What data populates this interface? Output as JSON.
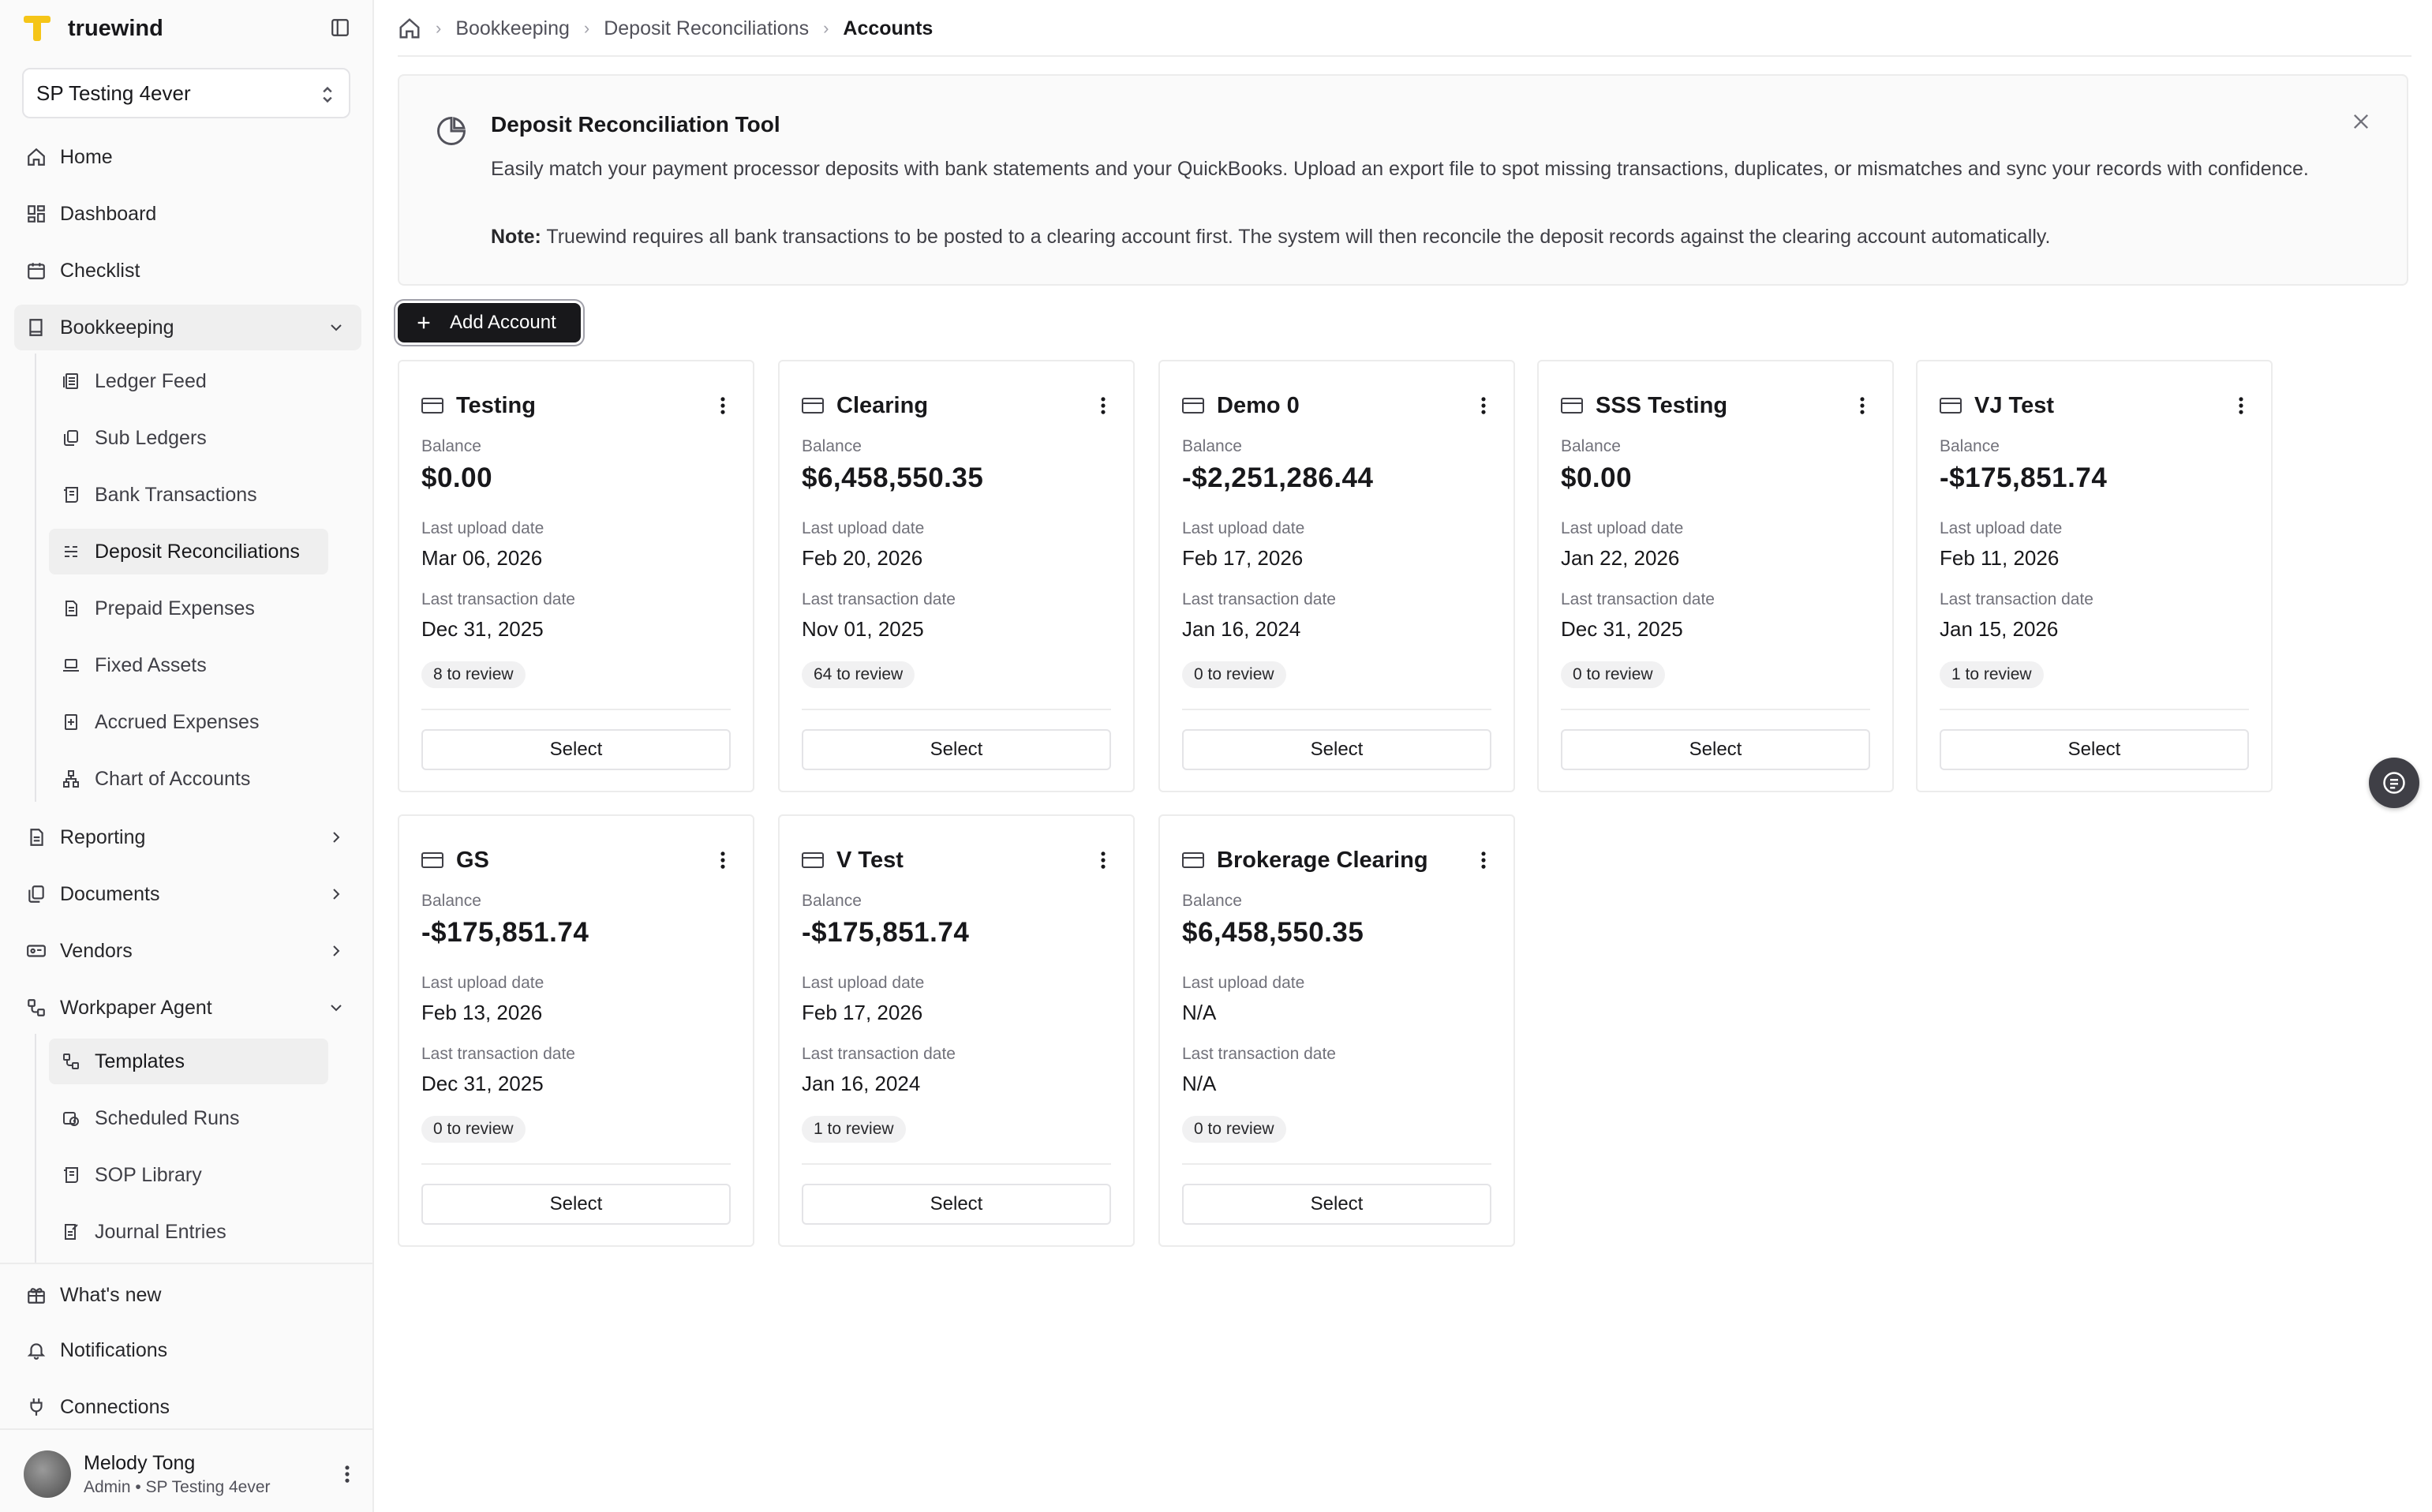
{
  "brand": {
    "name": "truewind",
    "color": "#f5c518"
  },
  "org_select": {
    "value": "SP Testing 4ever"
  },
  "nav": {
    "home": "Home",
    "dashboard": "Dashboard",
    "checklist": "Checklist",
    "bookkeeping": "Bookkeeping",
    "bookkeeping_items": [
      {
        "label": "Ledger Feed",
        "icon": "ledger-feed-icon"
      },
      {
        "label": "Sub Ledgers",
        "icon": "sub-ledgers-icon"
      },
      {
        "label": "Bank Transactions",
        "icon": "bank-transactions-icon"
      },
      {
        "label": "Deposit Reconciliations",
        "icon": "deposit-reconciliations-icon"
      },
      {
        "label": "Prepaid Expenses",
        "icon": "prepaid-expenses-icon"
      },
      {
        "label": "Fixed Assets",
        "icon": "fixed-assets-icon"
      },
      {
        "label": "Accrued Expenses",
        "icon": "accrued-expenses-icon"
      },
      {
        "label": "Chart of Accounts",
        "icon": "chart-of-accounts-icon"
      }
    ],
    "reporting": "Reporting",
    "documents": "Documents",
    "vendors": "Vendors",
    "workpaper_agent": "Workpaper Agent",
    "workpaper_items": [
      {
        "label": "Templates",
        "icon": "templates-icon"
      },
      {
        "label": "Scheduled Runs",
        "icon": "scheduled-runs-icon"
      },
      {
        "label": "SOP Library",
        "icon": "sop-library-icon"
      },
      {
        "label": "Journal Entries",
        "icon": "journal-entries-icon"
      }
    ],
    "whats_new": "What's new",
    "notifications": "Notifications",
    "connections": "Connections"
  },
  "user": {
    "name": "Melody Tong",
    "role": "Admin • SP Testing 4ever"
  },
  "breadcrumb": {
    "level1": "Bookkeeping",
    "level2": "Deposit Reconciliations",
    "current": "Accounts"
  },
  "banner": {
    "title": "Deposit Reconciliation Tool",
    "description": "Easily match your payment processor deposits with bank statements and your QuickBooks. Upload an export file to spot missing transactions, duplicates, or mismatches and sync your records with confidence.",
    "note_label": "Note:",
    "note_text": " Truewind requires all bank transactions to be posted to a clearing account first. The system will then reconcile the deposit records against the clearing account automatically."
  },
  "add_account_label": "Add Account",
  "labels": {
    "balance": "Balance",
    "last_upload": "Last upload date",
    "last_transaction": "Last transaction date",
    "select": "Select"
  },
  "accounts": [
    {
      "name": "Testing",
      "balance": "$0.00",
      "last_upload": "Mar 06, 2026",
      "last_transaction": "Dec 31, 2025",
      "review": "8 to review"
    },
    {
      "name": "Clearing",
      "balance": "$6,458,550.35",
      "last_upload": "Feb 20, 2026",
      "last_transaction": "Nov 01, 2025",
      "review": "64 to review"
    },
    {
      "name": "Demo 0",
      "balance": "-$2,251,286.44",
      "last_upload": "Feb 17, 2026",
      "last_transaction": "Jan 16, 2024",
      "review": "0 to review"
    },
    {
      "name": "SSS Testing",
      "balance": "$0.00",
      "last_upload": "Jan 22, 2026",
      "last_transaction": "Dec 31, 2025",
      "review": "0 to review"
    },
    {
      "name": "VJ Test",
      "balance": "-$175,851.74",
      "last_upload": "Feb 11, 2026",
      "last_transaction": "Jan 15, 2026",
      "review": "1 to review"
    },
    {
      "name": "GS",
      "balance": "-$175,851.74",
      "last_upload": "Feb 13, 2026",
      "last_transaction": "Dec 31, 2025",
      "review": "0 to review"
    },
    {
      "name": "V Test",
      "balance": "-$175,851.74",
      "last_upload": "Feb 17, 2026",
      "last_transaction": "Jan 16, 2024",
      "review": "1 to review"
    },
    {
      "name": "Brokerage Clearing",
      "balance": "$6,458,550.35",
      "last_upload": "N/A",
      "last_transaction": "N/A",
      "review": "0 to review"
    }
  ]
}
